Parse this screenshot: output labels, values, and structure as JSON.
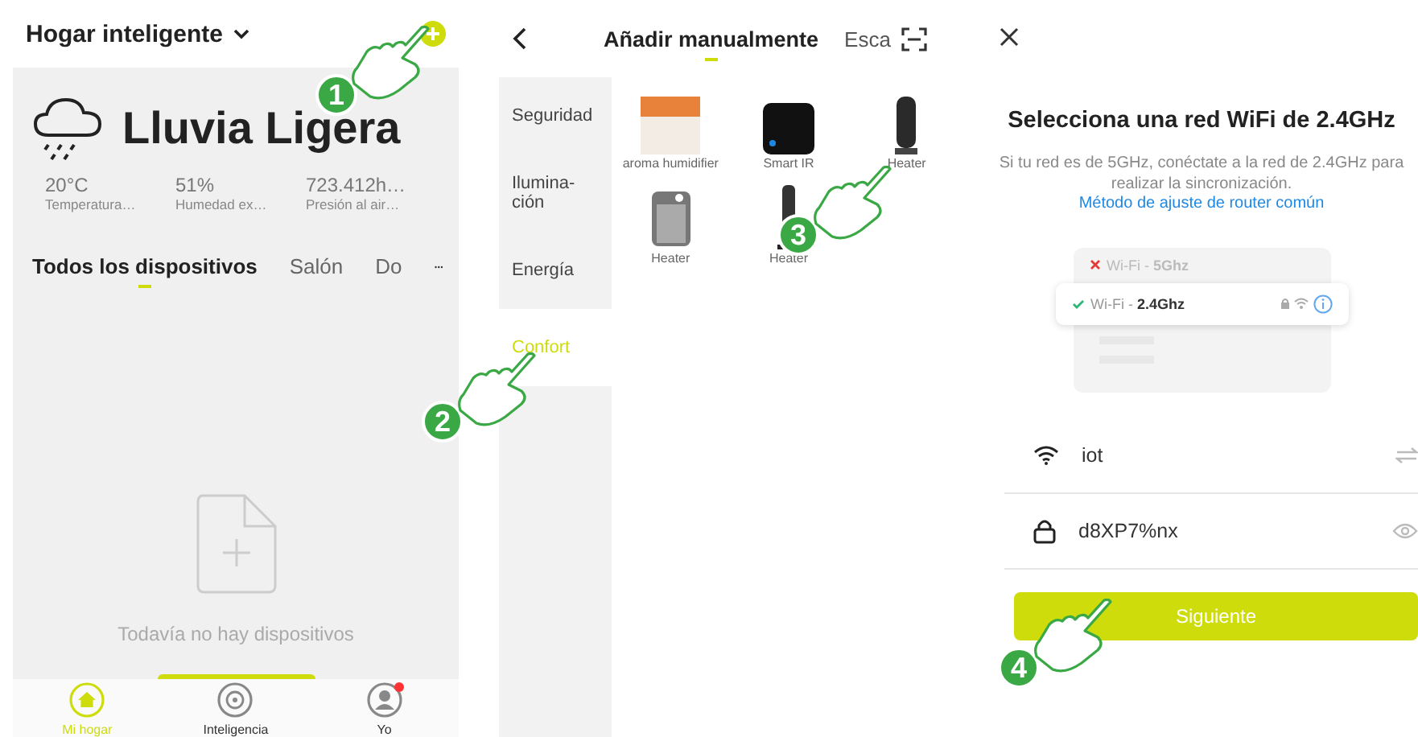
{
  "home": {
    "title": "Hogar inteligente",
    "weather": {
      "condition": "Lluvia Ligera",
      "stats": [
        {
          "value": "20°C",
          "label": "Temperatura…"
        },
        {
          "value": "51%",
          "label": "Humedad ex…"
        },
        {
          "value": "723.412h…",
          "label": "Presión al air…"
        }
      ]
    },
    "tabs": [
      {
        "label": "Todos los dispositivos",
        "selected": true
      },
      {
        "label": "Salón",
        "selected": false
      },
      {
        "label": "Do",
        "selected": false
      }
    ],
    "empty_message": "Todavía no hay dispositivos",
    "nav": [
      {
        "label": "Mi hogar",
        "kind": "home",
        "selected": true,
        "badge": false
      },
      {
        "label": "Inteligencia",
        "kind": "smart",
        "selected": false,
        "badge": false
      },
      {
        "label": "Yo",
        "kind": "profile",
        "selected": false,
        "badge": true
      }
    ]
  },
  "add_device": {
    "title": "Añadir manualmente",
    "scan_tab": "Esca",
    "categories": [
      {
        "label": "Seguridad",
        "selected": false
      },
      {
        "label": "Ilumina-ción",
        "selected": false
      },
      {
        "label": "Energía",
        "selected": false
      },
      {
        "label": "Confort",
        "selected": true
      }
    ],
    "products": [
      {
        "name": "aroma humidifier",
        "kind": "photo"
      },
      {
        "name": "Smart IR",
        "kind": "ir"
      },
      {
        "name": "Heater",
        "kind": "tower"
      },
      {
        "name": "Heater",
        "kind": "panel"
      },
      {
        "name": "Heater",
        "kind": "slim"
      }
    ]
  },
  "wifi": {
    "title": "Selecciona una red WiFi de 2.4GHz",
    "description": "Si tu red es de 5GHz, conéctate a la red de 2.4GHz para realizar la sincronización.",
    "link": "Método de ajuste de router común",
    "networks": [
      {
        "label": "Wi-Fi - **5Ghz**",
        "selected": false
      },
      {
        "label": "Wi-Fi - **2.4Ghz**",
        "selected": true
      }
    ],
    "ssid": "iot",
    "password": "d8XP7%nx",
    "button": "Siguiente"
  },
  "steps": [
    "1",
    "2",
    "3",
    "4"
  ]
}
